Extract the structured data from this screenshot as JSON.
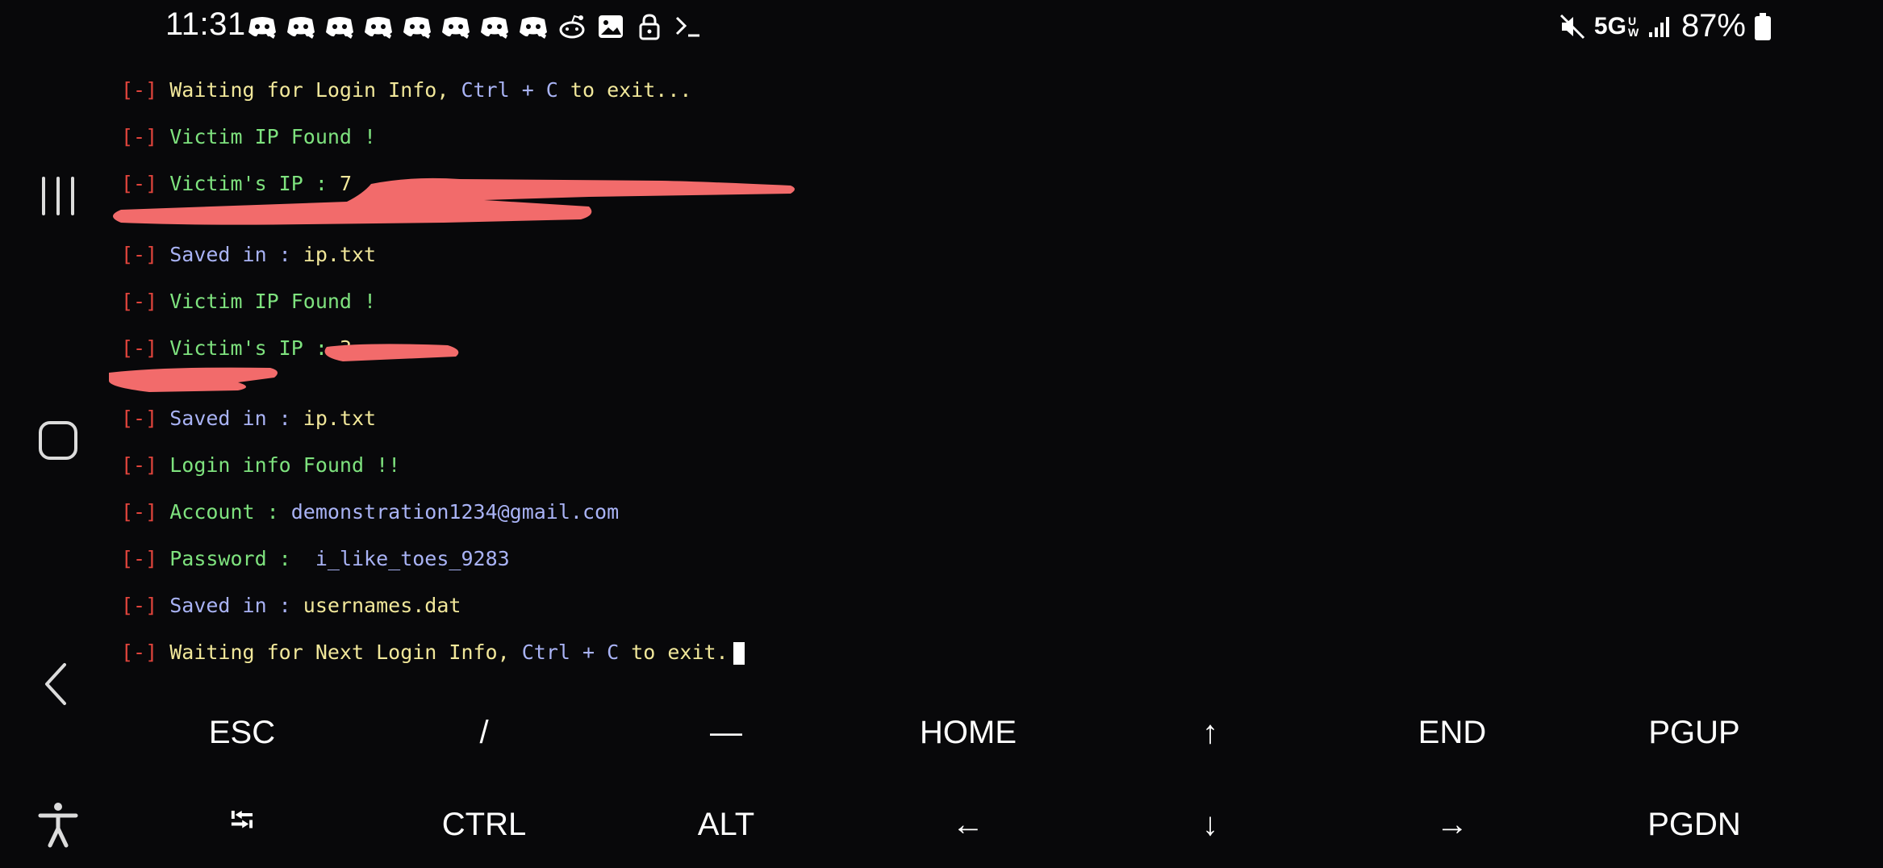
{
  "status_bar": {
    "time": "11:31",
    "network": "5G",
    "network_sub": "UW",
    "battery": "87%"
  },
  "notification_icons": [
    "discord-icon",
    "discord-icon",
    "discord-icon",
    "discord-icon",
    "discord-icon",
    "discord-icon",
    "discord-icon",
    "discord-icon",
    "reddit-icon",
    "gallery-icon",
    "lock-icon",
    "terminal-icon"
  ],
  "nav": {
    "recents": "recents-icon",
    "home": "home-icon",
    "back": "back-icon",
    "accessibility": "accessibility-icon"
  },
  "terminal": {
    "prefix": "[-]",
    "lines": [
      {
        "a": "Waiting for Login Info, ",
        "b": "Ctrl + C",
        "c": " to exit..."
      },
      {
        "a": "Victim IP Found !"
      },
      {
        "a": "Victim's IP : ",
        "b": "7"
      },
      {
        "a": "Saved in : ",
        "b": "ip.txt"
      },
      {
        "a": "Victim IP Found !"
      },
      {
        "a": "Victim's IP : ",
        "b": "3"
      },
      {
        "a": "Saved in : ",
        "b": "ip.txt"
      },
      {
        "a": "Login info Found !!"
      },
      {
        "a": "Account : ",
        "b": "demonstration1234@gmail.com"
      },
      {
        "a": "Password : ",
        "b": " i_like_toes_9283"
      },
      {
        "a": "Saved in : ",
        "b": "usernames.dat"
      },
      {
        "a": "Waiting for Next Login Info, ",
        "b": "Ctrl + C",
        "c": " to exit."
      }
    ]
  },
  "extra_keys": {
    "row1": [
      "ESC",
      "/",
      "—",
      "HOME",
      "↑",
      "END",
      "PGUP"
    ],
    "row2": [
      "⭾",
      "CTRL",
      "ALT",
      "←",
      "↓",
      "→",
      "PGDN"
    ]
  },
  "colors": {
    "background": "#08080a",
    "prefix": "#e0443c",
    "yellow_text": "#f1e79a",
    "green_text": "#7ee27e",
    "blue_text": "#a9b3f5",
    "redaction": "#f26b6b"
  }
}
